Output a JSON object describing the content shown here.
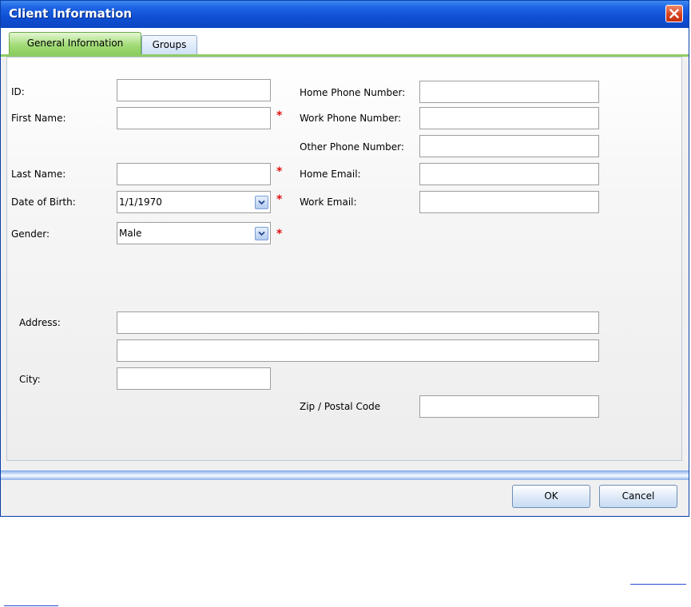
{
  "window": {
    "title": "Client Information"
  },
  "tabs": [
    {
      "label": "General Information",
      "selected": true
    },
    {
      "label": "Groups",
      "selected": false
    }
  ],
  "form": {
    "id": {
      "label": "ID:",
      "value": ""
    },
    "first_name": {
      "label": "First Name:",
      "value": "",
      "required": true
    },
    "last_name": {
      "label": "Last Name:",
      "value": "",
      "required": true
    },
    "date_of_birth": {
      "label": "Date of Birth:",
      "value": "1/1/1970",
      "required": true
    },
    "gender": {
      "label": "Gender:",
      "value": "Male",
      "required": true
    },
    "home_phone": {
      "label": "Home Phone Number:",
      "value": ""
    },
    "work_phone": {
      "label": "Work Phone Number:",
      "value": ""
    },
    "other_phone": {
      "label": "Other Phone Number:",
      "value": ""
    },
    "home_email": {
      "label": "Home Email:",
      "value": ""
    },
    "work_email": {
      "label": "Work Email:",
      "value": ""
    },
    "address": {
      "label": "Address:",
      "line1": "",
      "line2": ""
    },
    "city": {
      "label": "City:",
      "value": ""
    },
    "zip": {
      "label": "Zip / Postal Code",
      "value": ""
    },
    "required_marker": "*"
  },
  "buttons": {
    "ok": "OK",
    "cancel": "Cancel"
  },
  "colors": {
    "titlebar": "#0f4fd4",
    "required": "#e01010",
    "tab_selected": "#a3dc78"
  },
  "icons": {
    "close": "close-icon",
    "dropdown": "chevron-down-icon"
  }
}
